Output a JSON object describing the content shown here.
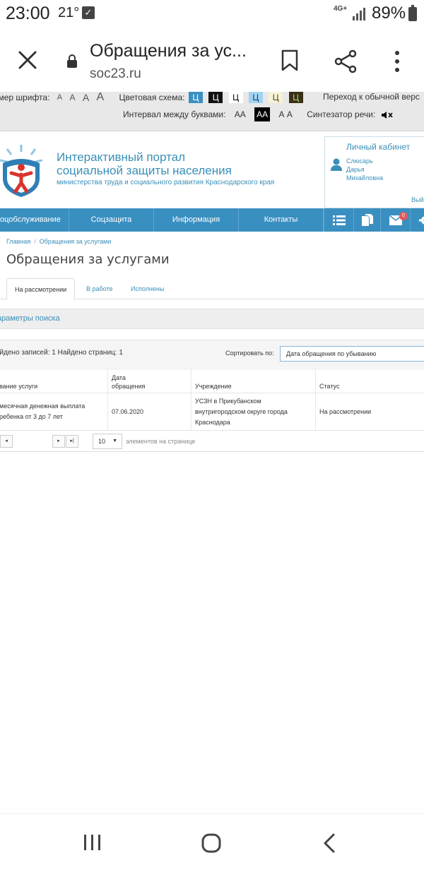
{
  "status_bar": {
    "time": "23:00",
    "temperature": "21°",
    "network": "4G+",
    "battery": "89%"
  },
  "browser": {
    "tab_title": "Обращения за ус...",
    "url": "soc23.ru"
  },
  "accessibility": {
    "font_size_label": "змер шрифта:",
    "font_sizes": [
      "A",
      "A",
      "A",
      "A"
    ],
    "color_scheme_label": "Цветовая схема:",
    "color_schemes": [
      "Ц",
      "Ц",
      "Ц",
      "Ц",
      "Ц",
      "Ц"
    ],
    "normal_version": "Переход к обычной верс",
    "spacing_label": "Интервал между буквами:",
    "spacing_options": [
      "АА",
      "АА",
      "А А"
    ],
    "speech_label": "Синтезатор речи:"
  },
  "header": {
    "title_line1": "Интерактивный портал",
    "title_line2": "социальной защиты населения",
    "subtitle": "министерства труда и социального развития Краснодарского края",
    "cabinet_title": "Личный кабинет",
    "user_name_line1": "Слюсарь",
    "user_name_line2": "Дарья",
    "user_name_line3": "Михайловна",
    "exit": "Вый"
  },
  "nav": {
    "items": [
      "оцобслуживание",
      "Соцзащита",
      "Информация",
      "Контакты"
    ],
    "messages_count": "0"
  },
  "breadcrumb": {
    "home": "Главная",
    "separator": "/",
    "current": "Обращения за услугами"
  },
  "page": {
    "title": "Обращения за услугами",
    "tabs": [
      "На рассмотрении",
      "В работе",
      "Исполнены"
    ]
  },
  "search": {
    "title": "араметры поиска"
  },
  "results": {
    "found": "айдено записей: 1 Найдено страниц: 1",
    "sort_label": "Сортировать по:",
    "sort_value": "Дата обращения по убыванию"
  },
  "table": {
    "headers": [
      "вание услуги",
      "Дата обращения",
      "Учреждение",
      "Статус"
    ],
    "header_date_line1": "Дата",
    "header_date_line2": "обращения",
    "rows": [
      {
        "service_line1": "месячная денежная выплата",
        "service_line2": "ребенка от 3 до 7 лет",
        "date": "07.06.2020",
        "institution_line1": "УСЗН в Прикубанском",
        "institution_line2": "внутригородском округе города",
        "institution_line3": "Краснодара",
        "status": "На рассмотрении"
      }
    ]
  },
  "pager": {
    "prev": "◂",
    "next": "▸",
    "last": "▸|",
    "page_size": "10",
    "per_page_label": "элементов на странице"
  },
  "colors": {
    "primary": "#3a8fc1",
    "link": "#3a8fb7"
  }
}
